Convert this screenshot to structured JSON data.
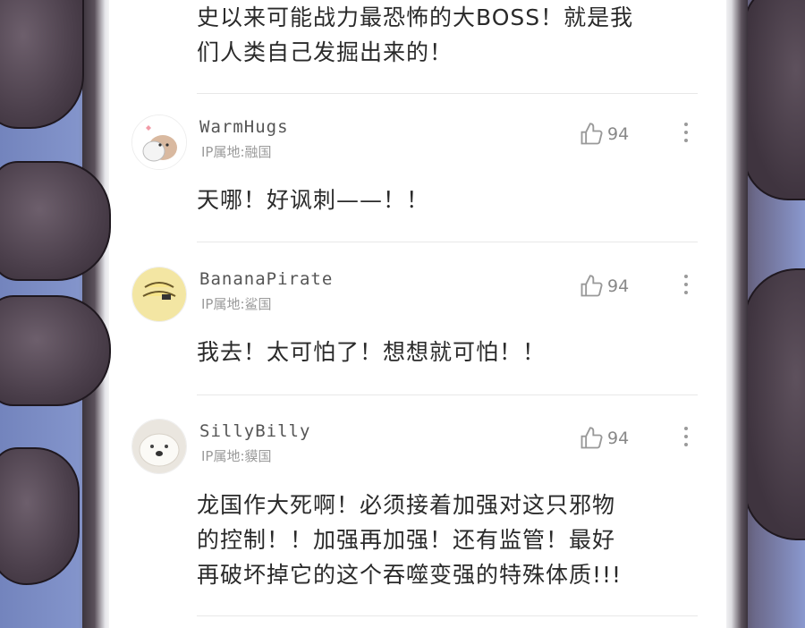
{
  "top_comment": {
    "line1": "史以来可能战力最恐怖的大BOSS！就是我",
    "line2": "们人类自己发掘出来的！"
  },
  "comments": [
    {
      "username": "WarmHugs",
      "ip": "IP属地:融国",
      "likes": "94",
      "body": [
        "天哪！好讽刺——！！"
      ]
    },
    {
      "username": "BananaPirate",
      "ip": "IP属地:鲨国",
      "likes": "94",
      "body": [
        "我去！太可怕了！想想就可怕！！"
      ]
    },
    {
      "username": "SillyBilly",
      "ip": "IP属地:貘国",
      "likes": "94",
      "body": [
        "龙国作大死啊！必须接着加强对这只邪物",
        "的控制！！加强再加强！还有监管！最好",
        "再破坏掉它的这个吞噬变强的特殊体质!!!"
      ]
    }
  ],
  "icons": {
    "like": "thumbs-up-icon",
    "more": "more-vertical-icon"
  },
  "colors": {
    "text": "#2a2a2a",
    "meta": "#9a9a9a",
    "background": "#ffffff"
  }
}
